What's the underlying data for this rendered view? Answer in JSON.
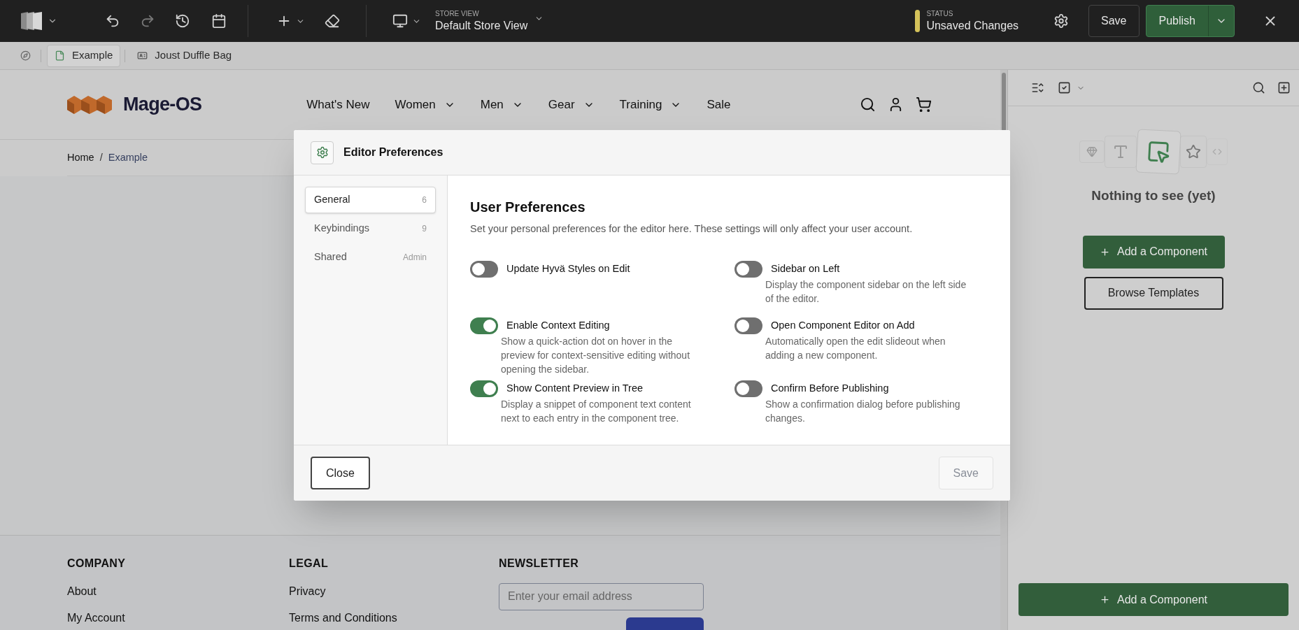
{
  "topbar": {
    "store_view": {
      "label": "STORE VIEW",
      "value": "Default Store View"
    },
    "status": {
      "label": "STATUS",
      "value": "Unsaved Changes",
      "color": "#d4c25a"
    },
    "save": "Save",
    "publish": "Publish"
  },
  "tabs": [
    {
      "label": "Example",
      "selected": true
    },
    {
      "label": "Joust Duffle Bag",
      "selected": false
    }
  ],
  "storefront": {
    "logo": "Mage-OS",
    "nav": [
      {
        "label": "What's New",
        "dropdown": false
      },
      {
        "label": "Women",
        "dropdown": true
      },
      {
        "label": "Men",
        "dropdown": true
      },
      {
        "label": "Gear",
        "dropdown": true
      },
      {
        "label": "Training",
        "dropdown": true
      },
      {
        "label": "Sale",
        "dropdown": false
      }
    ],
    "breadcrumbs": [
      "Home",
      "Example"
    ],
    "breadcrumb_separator": "/",
    "footer": [
      {
        "heading": "COMPANY",
        "links": [
          "About",
          "My Account"
        ]
      },
      {
        "heading": "LEGAL",
        "links": [
          "Privacy",
          "Terms and Conditions"
        ]
      }
    ],
    "newsletter": {
      "heading": "NEWSLETTER",
      "placeholder": "Enter your email address"
    }
  },
  "modal": {
    "title": "Editor Preferences",
    "nav": [
      {
        "label": "General",
        "count": "6",
        "selected": true
      },
      {
        "label": "Keybindings",
        "count": "9",
        "selected": false
      },
      {
        "label": "Shared",
        "count": "Admin",
        "selected": false
      }
    ],
    "heading": "User Preferences",
    "description": "Set your personal preferences for the editor here. These settings will only affect your user account.",
    "prefs": [
      {
        "label": "Update Hyvä Styles on Edit",
        "on": false
      },
      {
        "label": "Sidebar on Left",
        "description": "Display the component sidebar on the left side of the editor.",
        "on": false
      },
      {
        "label": "Enable Context Editing",
        "description": "Show a quick-action dot on hover in the preview for context-sensitive editing without opening the sidebar.",
        "on": true
      },
      {
        "label": "Open Component Editor on Add",
        "description": "Automatically open the edit slideout when adding a new component.",
        "on": false
      },
      {
        "label": "Show Content Preview in Tree",
        "description": "Display a snippet of component text content next to each entry in the component tree.",
        "on": true
      },
      {
        "label": "Confirm Before Publishing",
        "description": "Show a confirmation dialog before publishing changes.",
        "on": false
      }
    ],
    "close": "Close",
    "save": {
      "label": "Save",
      "disabled": true
    }
  },
  "panel": {
    "empty_title": "Nothing to see (yet)",
    "add": "Add a Component",
    "browse": "Browse Templates",
    "bottom_add": "Add a Component"
  }
}
